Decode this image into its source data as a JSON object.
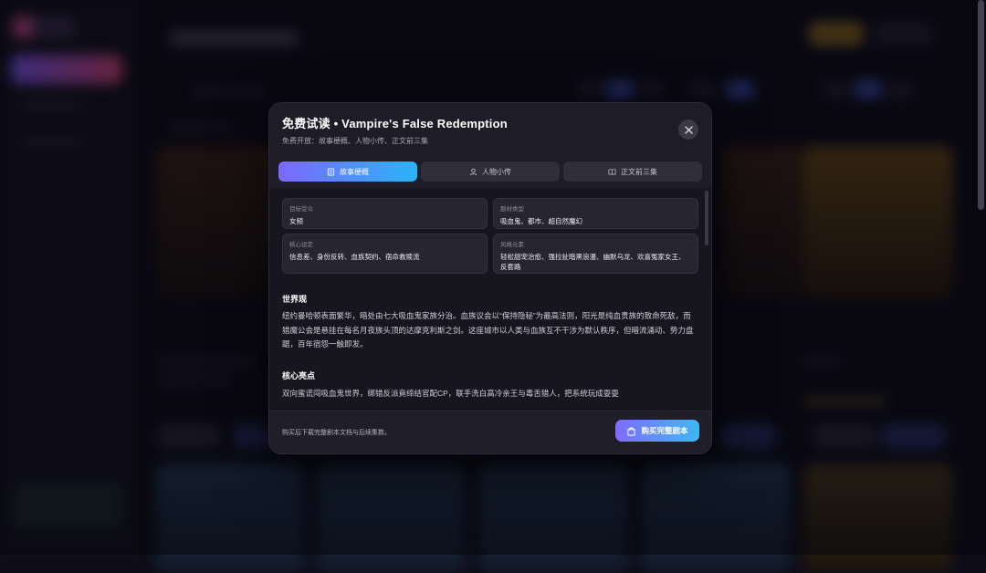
{
  "modal": {
    "title": "免费试读 • Vampire's False Redemption",
    "subtitle": "免费开放：故事梗概、人物小传、正文前三集",
    "close_icon": "close-icon",
    "tabs": [
      {
        "label": "故事梗概",
        "icon": "document-icon",
        "active": true
      },
      {
        "label": "人物小传",
        "icon": "user-icon",
        "active": false
      },
      {
        "label": "正文前三集",
        "icon": "book-icon",
        "active": false
      }
    ],
    "info": [
      {
        "label": "目标受众",
        "value": "女频"
      },
      {
        "label": "题材类型",
        "value": "吸血鬼、都市、超自然魔幻"
      },
      {
        "label": "核心设定",
        "value": "信息差、身份反转、血族契约、宿命救赎流"
      },
      {
        "label": "风格元素",
        "value": "轻松甜宠治愈、强拉扯暗黑浪漫、幽默乌龙、欢喜冤家女王、反套路"
      }
    ],
    "sections": [
      {
        "title": "世界观",
        "text": "纽约曼哈顿表面繁华，暗处由七大吸血鬼家族分治。血族议会以“保持隐秘”为最高法则，阳光是纯血贵族的致命死敌，而猎魔公会是悬挂在每名月夜族头顶的达摩克利斯之剑。这座城市以人类与血族互不干涉为默认秩序，但暗流涌动、势力盘踞，百年宿怨一触即发。"
      },
      {
        "title": "核心亮点",
        "text": "双向蜜谎闯吸血鬼世界，绑错反派竟缔结官配CP，联手洗白高冷亲王与毒舌猎人，把系统玩成耍耍"
      }
    ],
    "footer": {
      "note": "购买后下载完整剧本文档与后续集数。",
      "buy_label": "购买完整剧本",
      "buy_icon": "shopping-bag-icon"
    }
  },
  "colors": {
    "accent_start": "#7d68ff",
    "accent_end": "#2ab3f6",
    "modal_bg": "#1d1c27",
    "body_bg": "#17161f"
  }
}
